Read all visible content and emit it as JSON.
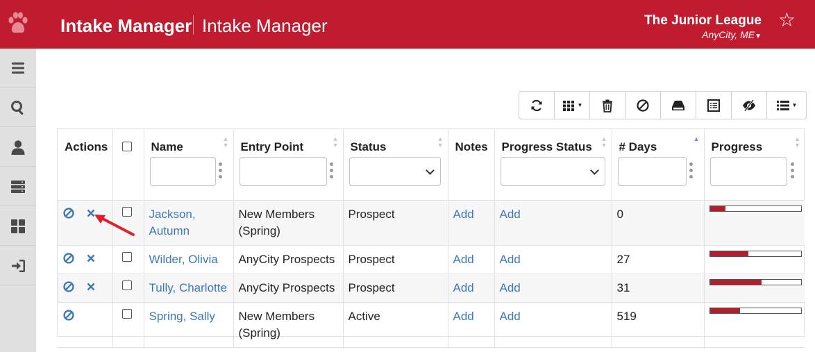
{
  "header": {
    "app_title": "Intake Manager",
    "page_title": "Intake Manager",
    "org_name": "The Junior League",
    "org_location": "AnyCity, ME",
    "logo_icon": "paw-icon",
    "star_icon": "star-icon"
  },
  "sidebar": {
    "items": [
      {
        "name": "menu",
        "icon": "menu-icon"
      },
      {
        "name": "search",
        "icon": "search-icon"
      },
      {
        "name": "user",
        "icon": "user-icon"
      },
      {
        "name": "server",
        "icon": "server-icon"
      },
      {
        "name": "dashboard",
        "icon": "grid-icon"
      },
      {
        "name": "logout",
        "icon": "sign-in-icon"
      }
    ]
  },
  "toolbar": {
    "buttons": [
      "refresh-icon",
      "columns-icon",
      "trash-icon",
      "ban-icon",
      "inbox-icon",
      "list-alt-icon",
      "eye-slash-icon",
      "list-icon"
    ]
  },
  "table": {
    "columns": {
      "actions": "Actions",
      "name": "Name",
      "entry_point": "Entry Point",
      "status": "Status",
      "notes": "Notes",
      "progress_status": "Progress Status",
      "days": "# Days",
      "progress": "Progress"
    },
    "rows": [
      {
        "name": "Jackson, Autumn",
        "entry_point": "New Members (Spring)",
        "status": "Prospect",
        "notes": "Add",
        "progress_status": "Add",
        "days": "0",
        "progress": 0.17,
        "can_delete": true
      },
      {
        "name": "Wilder, Olivia",
        "entry_point": "AnyCity Prospects",
        "status": "Prospect",
        "notes": "Add",
        "progress_status": "Add",
        "days": "27",
        "progress": 0.42,
        "can_delete": true
      },
      {
        "name": "Tully, Charlotte",
        "entry_point": "AnyCity Prospects",
        "status": "Prospect",
        "notes": "Add",
        "progress_status": "Add",
        "days": "31",
        "progress": 0.57,
        "can_delete": true
      },
      {
        "name": "Spring, Sally",
        "entry_point": "New Members (Spring)",
        "status": "Active",
        "notes": "Add",
        "progress_status": "Add",
        "days": "519",
        "progress": 0.33,
        "can_delete": false
      }
    ]
  },
  "colors": {
    "header_bg": "#c01b2e",
    "link": "#3c78b9",
    "progress_fill": "#b11f2c",
    "annotation_arrow": "#e0202a"
  }
}
